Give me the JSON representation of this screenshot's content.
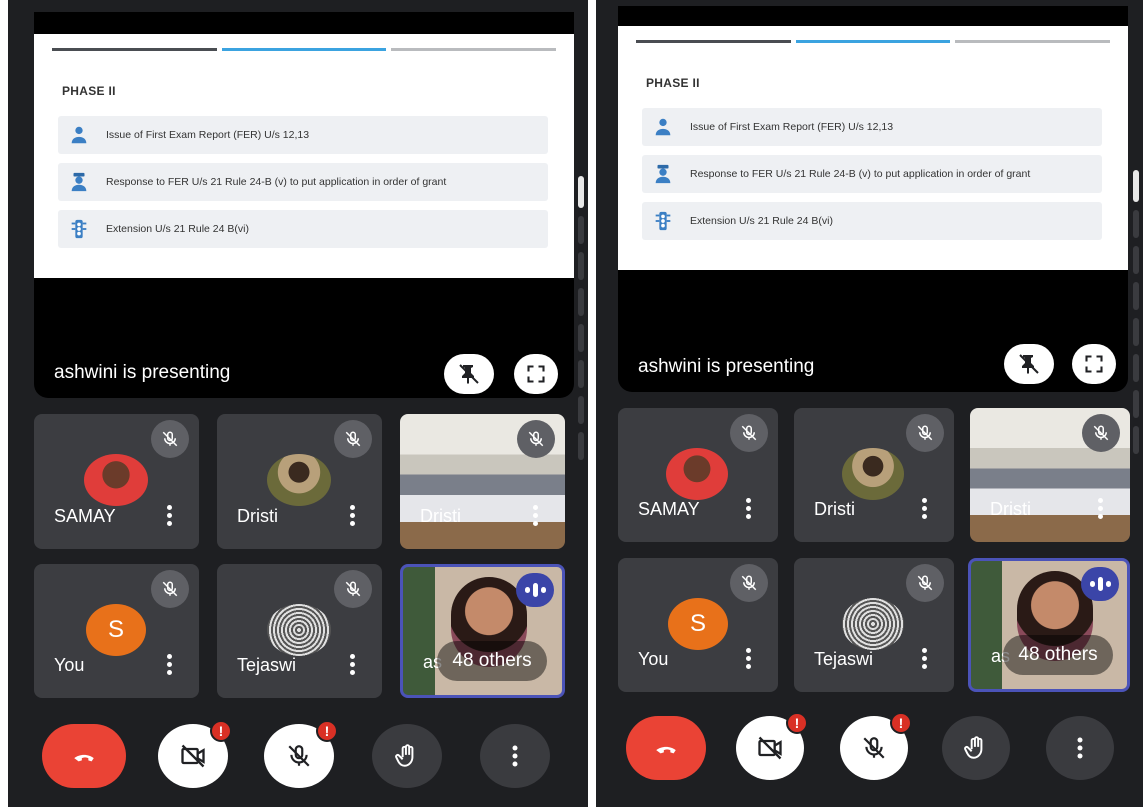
{
  "phones": [
    {
      "id": "left",
      "slide": {
        "phase_title": "PHASE II",
        "progress_colors": [
          "#4a4d52",
          "#3ba3e0",
          "#b9bbbe"
        ],
        "rows": [
          {
            "icon": "person-icon",
            "text": "Issue of First Exam Report (FER) U/s 12,13"
          },
          {
            "icon": "officer-icon",
            "text": "Response to FER U/s 21 Rule 24-B (v) to put application in order of grant"
          },
          {
            "icon": "traffic-light-icon",
            "text": "Extension U/s 21 Rule 24 B(vi)"
          }
        ]
      },
      "presenting_text": "ashwini is presenting",
      "participants": [
        {
          "name": "SAMAY",
          "muted": true
        },
        {
          "name": "Dristi",
          "muted": true
        },
        {
          "name": "Dristi",
          "muted": true
        },
        {
          "name": "You",
          "initial": "S",
          "muted": true
        },
        {
          "name": "Tejaswi",
          "muted": true
        },
        {
          "name": "as",
          "others_label": "48 others",
          "speaking": true
        }
      ],
      "controls": [
        "end-call",
        "camera-off",
        "mic-off",
        "raise-hand",
        "more"
      ],
      "alert_badge": "!"
    },
    {
      "id": "right",
      "slide": {
        "phase_title": "PHASE II",
        "progress_colors": [
          "#4a4d52",
          "#3ba3e0",
          "#b9bbbe"
        ],
        "rows": [
          {
            "icon": "person-icon",
            "text": "Issue of First Exam Report (FER) U/s 12,13"
          },
          {
            "icon": "officer-icon",
            "text": "Response to FER U/s 21 Rule 24-B (v) to put application in order of grant"
          },
          {
            "icon": "traffic-light-icon",
            "text": "Extension U/s 21 Rule 24 B(vi)"
          }
        ]
      },
      "presenting_text": "ashwini is presenting",
      "participants": [
        {
          "name": "SAMAY",
          "muted": true
        },
        {
          "name": "Dristi",
          "muted": true
        },
        {
          "name": "Dristi",
          "muted": true
        },
        {
          "name": "You",
          "initial": "S",
          "muted": true
        },
        {
          "name": "Tejaswi",
          "muted": true
        },
        {
          "name": "as",
          "others_label": "48 others",
          "speaking": true
        }
      ],
      "controls": [
        "end-call",
        "camera-off",
        "mic-off",
        "raise-hand",
        "more"
      ],
      "alert_badge": "!"
    }
  ],
  "colors": {
    "end_call": "#ea4335",
    "alert": "#d93025",
    "speaking_bg": "#3b45a8",
    "active_border": "#4b53b8",
    "tile_bg": "#3c3d41",
    "app_bg": "#1e1f22"
  }
}
